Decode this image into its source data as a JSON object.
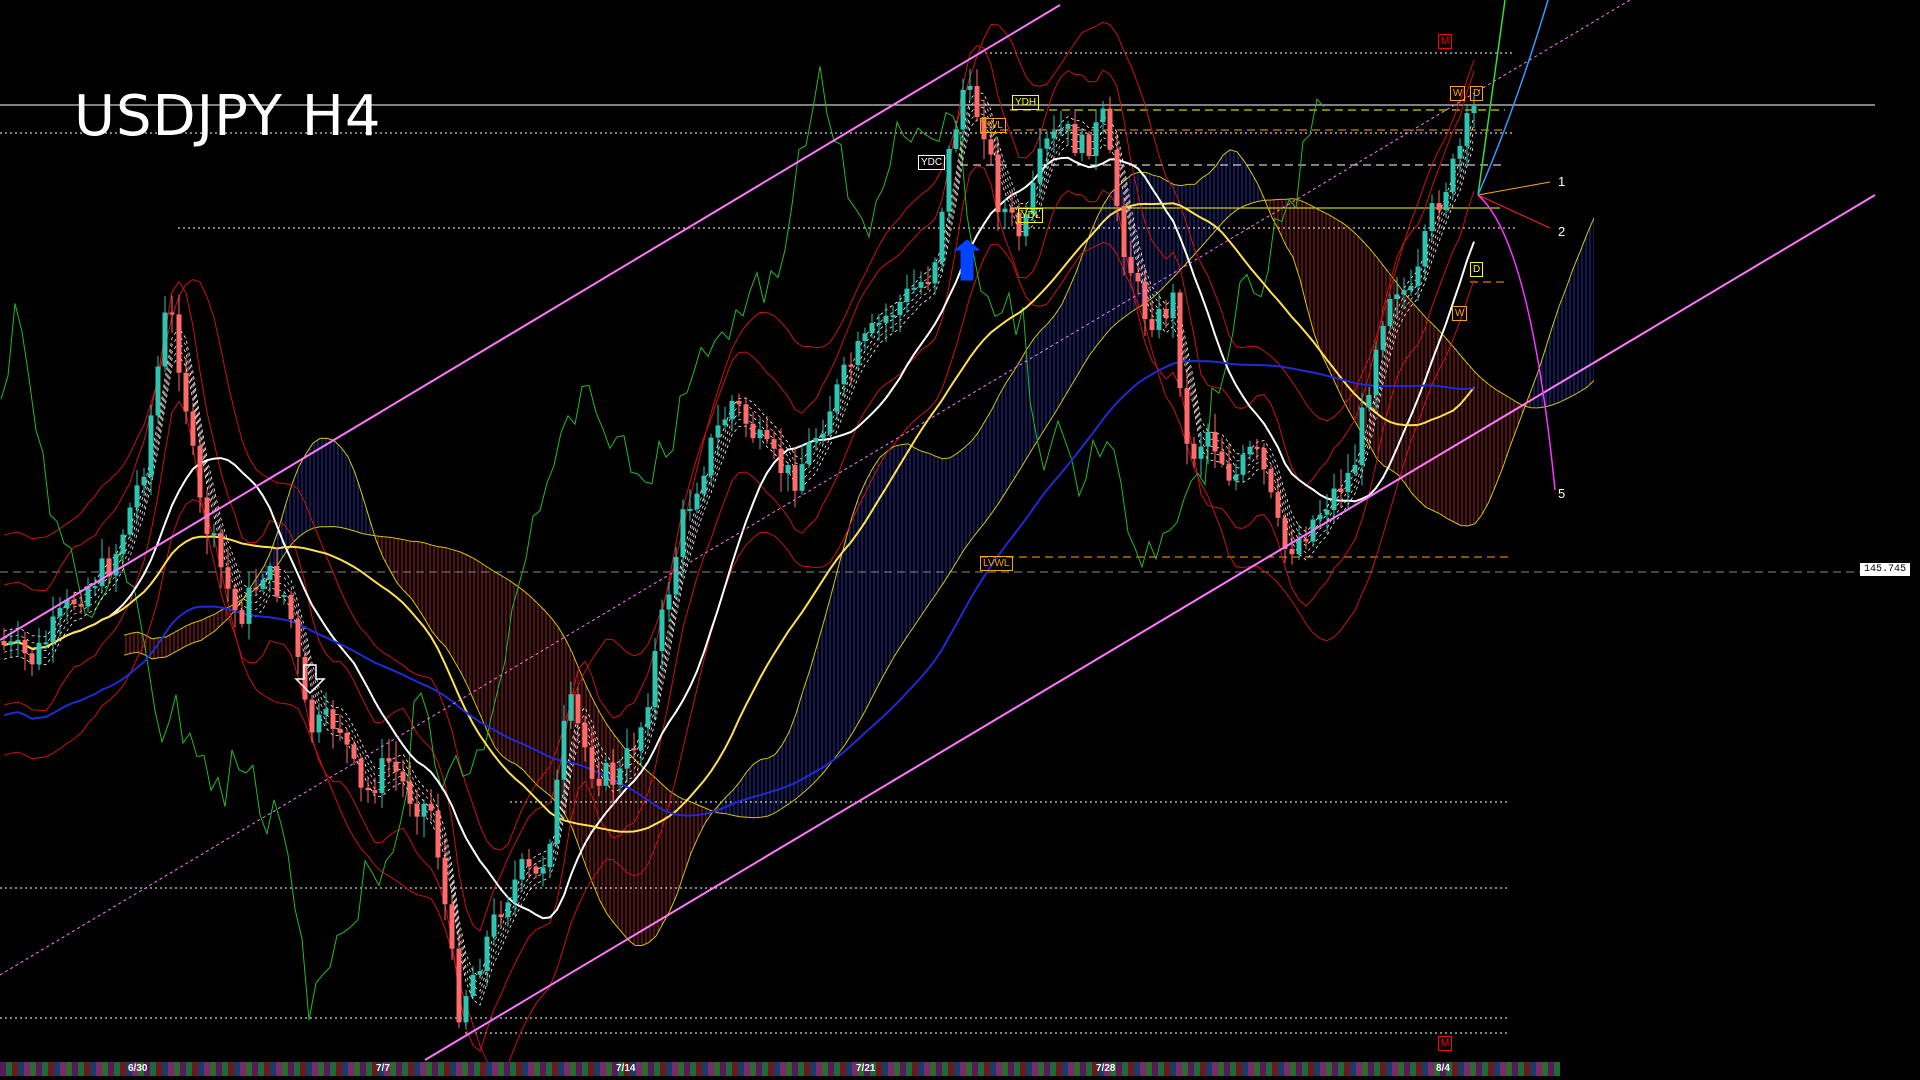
{
  "title": "USDJPY H4",
  "price_marker": "145.745",
  "date_labels": [
    {
      "text": "6/30"
    },
    {
      "text": "7/7"
    },
    {
      "text": "7/14"
    },
    {
      "text": "7/21"
    },
    {
      "text": "7/28"
    },
    {
      "text": "8/4"
    }
  ],
  "forecast_labels": [
    "1",
    "2",
    "5"
  ],
  "level_boxes": [
    {
      "text": "YDC",
      "color": "#ffffff"
    },
    {
      "text": "YDH",
      "color": "#ffff00"
    },
    {
      "text": "LWL",
      "color": "#ffa500"
    },
    {
      "text": "YDL",
      "color": "#ffff00"
    },
    {
      "text": "LVWL",
      "color": "#ffa500"
    },
    {
      "text": "W",
      "color": "#ffa500"
    },
    {
      "text": "D",
      "color": "#ffa500"
    },
    {
      "text": "D",
      "color": "#ffff00"
    },
    {
      "text": "W",
      "color": "#ffa500"
    },
    {
      "text": "M",
      "color": "#ff0000"
    },
    {
      "text": "M",
      "color": "#ff0000"
    }
  ],
  "colors": {
    "bull_candle": "#2ec4b0",
    "bear_candle": "#ff6b6b",
    "channel": "#ff77ff",
    "ma_white": "#ffffff",
    "ma_yellow": "#ffe14d",
    "ma_blue": "#1e2bd6",
    "bollinger": "#cc1111",
    "chikou": "#22bb22",
    "ichimoku_span": "#d4c400",
    "cloud_bull": "#2233aa",
    "cloud_bear": "#aa2222"
  },
  "chart_data": {
    "type": "candlestick",
    "symbol": "USDJPY",
    "timeframe": "H4",
    "x_labels": [
      "6/30",
      "7/7",
      "7/14",
      "7/21",
      "7/28",
      "8/4"
    ],
    "series": [
      {
        "values": [
          143.2,
          143.9,
          144.6,
          145.3,
          146.1,
          147.0,
          147.9,
          146.8,
          145.5,
          144.8,
          145.2,
          144.3,
          143.6,
          144.1,
          143.4,
          142.9,
          143.5,
          143.0,
          142.2,
          141.6,
          141.1,
          140.5,
          141.3,
          142.6,
          144.0,
          145.2,
          146.0,
          146.8,
          147.4,
          146.9,
          146.2,
          145.6,
          146.4,
          147.1,
          147.8,
          148.4,
          148.9,
          149.6,
          150.4,
          149.0,
          148.2,
          149.5,
          150.1,
          149.8,
          149.3,
          148.5,
          147.6,
          147.0,
          146.3,
          145.8,
          145.3,
          146.2,
          147.2,
          148.3,
          149.0,
          149.6,
          150.0,
          149.4,
          148.6,
          149.1
        ]
      }
    ],
    "annotations": [
      "USDJPY H4",
      "145.745"
    ]
  }
}
